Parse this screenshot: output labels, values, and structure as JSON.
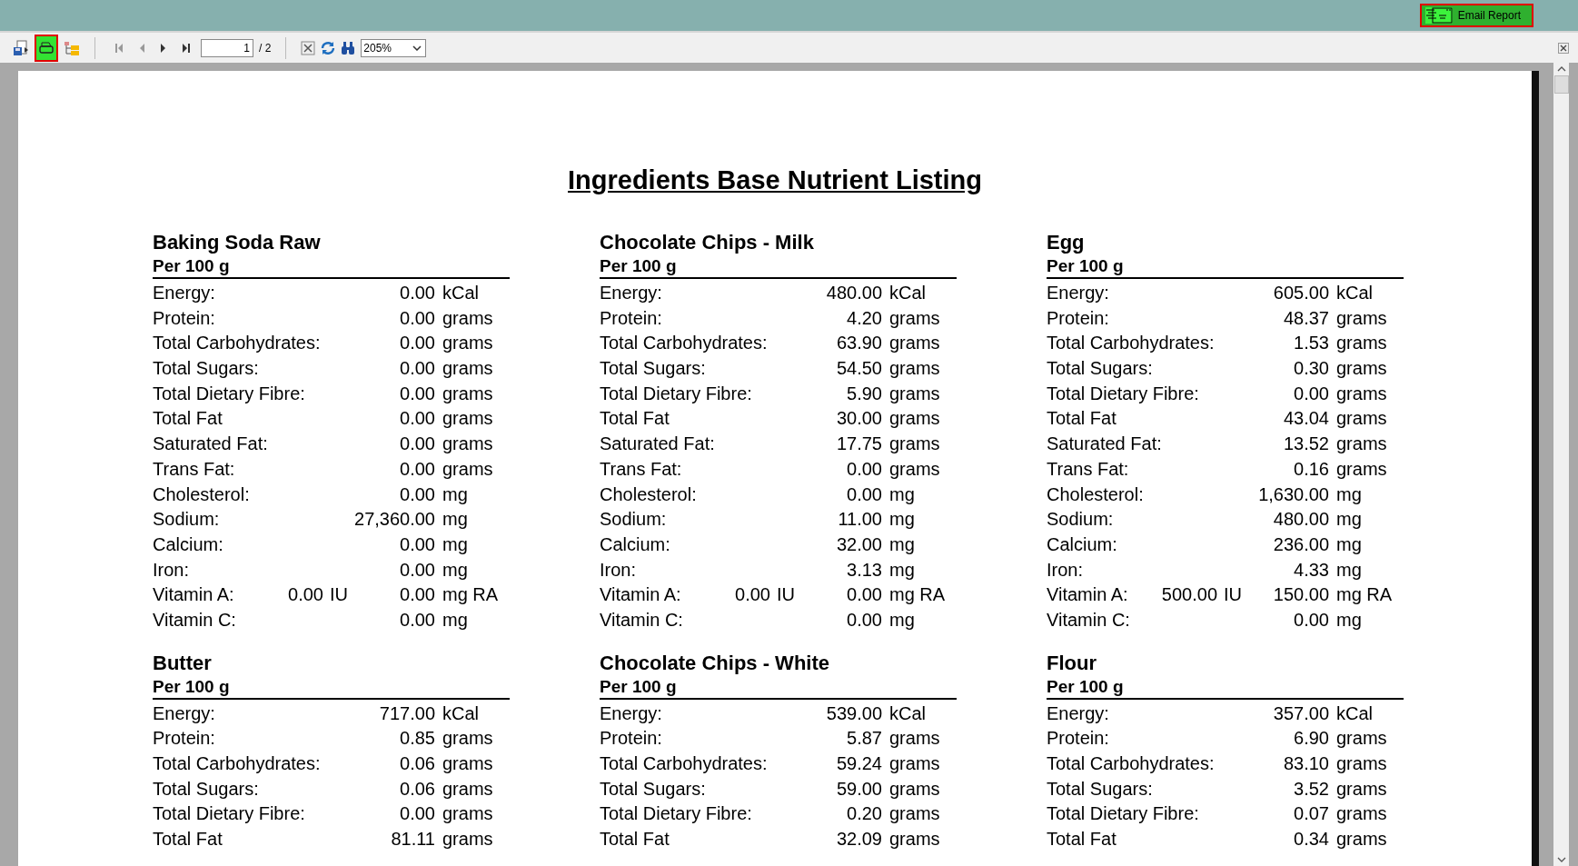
{
  "top_bar": {
    "email_button": "Email Report"
  },
  "toolbar": {
    "page_number": "1",
    "page_total": "/ 2",
    "zoom": "205%",
    "print_selected": true
  },
  "report": {
    "title": "Ingredients Base Nutrient Listing",
    "items": [
      {
        "name": "Baking Soda Raw",
        "per": "Per 100 g",
        "rows": [
          {
            "label": "Energy:",
            "value": "0.00",
            "unit": "kCal"
          },
          {
            "label": "Protein:",
            "value": "0.00",
            "unit": "grams"
          },
          {
            "label": "Total Carbohydrates:",
            "value": "0.00",
            "unit": "grams"
          },
          {
            "label": "Total Sugars:",
            "value": "0.00",
            "unit": "grams"
          },
          {
            "label": "Total Dietary Fibre:",
            "value": "0.00",
            "unit": "grams"
          },
          {
            "label": "Total Fat",
            "value": "0.00",
            "unit": "grams"
          },
          {
            "label": "Saturated Fat:",
            "value": "0.00",
            "unit": "grams"
          },
          {
            "label": "Trans Fat:",
            "value": "0.00",
            "unit": "grams"
          },
          {
            "label": "Cholesterol:",
            "value": "0.00",
            "unit": "mg"
          },
          {
            "label": "Sodium:",
            "value": "27,360.00",
            "unit": "mg"
          },
          {
            "label": "Calcium:",
            "value": "0.00",
            "unit": "mg"
          },
          {
            "label": "Iron:",
            "value": "0.00",
            "unit": "mg"
          },
          {
            "label": "Vitamin A:",
            "iu_value": "0.00",
            "iu_unit": "IU",
            "value": "0.00",
            "unit": "mg RA"
          },
          {
            "label": "Vitamin C:",
            "value": "0.00",
            "unit": "mg"
          }
        ]
      },
      {
        "name": "Chocolate Chips - Milk",
        "per": "Per 100 g",
        "rows": [
          {
            "label": "Energy:",
            "value": "480.00",
            "unit": "kCal"
          },
          {
            "label": "Protein:",
            "value": "4.20",
            "unit": "grams"
          },
          {
            "label": "Total Carbohydrates:",
            "value": "63.90",
            "unit": "grams"
          },
          {
            "label": "Total Sugars:",
            "value": "54.50",
            "unit": "grams"
          },
          {
            "label": "Total Dietary Fibre:",
            "value": "5.90",
            "unit": "grams"
          },
          {
            "label": "Total Fat",
            "value": "30.00",
            "unit": "grams"
          },
          {
            "label": "Saturated Fat:",
            "value": "17.75",
            "unit": "grams"
          },
          {
            "label": "Trans Fat:",
            "value": "0.00",
            "unit": "grams"
          },
          {
            "label": "Cholesterol:",
            "value": "0.00",
            "unit": "mg"
          },
          {
            "label": "Sodium:",
            "value": "11.00",
            "unit": "mg"
          },
          {
            "label": "Calcium:",
            "value": "32.00",
            "unit": "mg"
          },
          {
            "label": "Iron:",
            "value": "3.13",
            "unit": "mg"
          },
          {
            "label": "Vitamin A:",
            "iu_value": "0.00",
            "iu_unit": "IU",
            "value": "0.00",
            "unit": "mg RA"
          },
          {
            "label": "Vitamin C:",
            "value": "0.00",
            "unit": "mg"
          }
        ]
      },
      {
        "name": "Egg",
        "per": "Per 100 g",
        "rows": [
          {
            "label": "Energy:",
            "value": "605.00",
            "unit": "kCal"
          },
          {
            "label": "Protein:",
            "value": "48.37",
            "unit": "grams"
          },
          {
            "label": "Total Carbohydrates:",
            "value": "1.53",
            "unit": "grams"
          },
          {
            "label": "Total Sugars:",
            "value": "0.30",
            "unit": "grams"
          },
          {
            "label": "Total Dietary Fibre:",
            "value": "0.00",
            "unit": "grams"
          },
          {
            "label": "Total Fat",
            "value": "43.04",
            "unit": "grams"
          },
          {
            "label": "Saturated Fat:",
            "value": "13.52",
            "unit": "grams"
          },
          {
            "label": "Trans Fat:",
            "value": "0.16",
            "unit": "grams"
          },
          {
            "label": "Cholesterol:",
            "value": "1,630.00",
            "unit": "mg"
          },
          {
            "label": "Sodium:",
            "value": "480.00",
            "unit": "mg"
          },
          {
            "label": "Calcium:",
            "value": "236.00",
            "unit": "mg"
          },
          {
            "label": "Iron:",
            "value": "4.33",
            "unit": "mg"
          },
          {
            "label": "Vitamin A:",
            "iu_value": "500.00",
            "iu_unit": "IU",
            "value": "150.00",
            "unit": "mg RA"
          },
          {
            "label": "Vitamin C:",
            "value": "0.00",
            "unit": "mg"
          }
        ]
      },
      {
        "name": "Butter",
        "per": "Per 100 g",
        "rows": [
          {
            "label": "Energy:",
            "value": "717.00",
            "unit": "kCal"
          },
          {
            "label": "Protein:",
            "value": "0.85",
            "unit": "grams"
          },
          {
            "label": "Total Carbohydrates:",
            "value": "0.06",
            "unit": "grams"
          },
          {
            "label": "Total Sugars:",
            "value": "0.06",
            "unit": "grams"
          },
          {
            "label": "Total Dietary Fibre:",
            "value": "0.00",
            "unit": "grams"
          },
          {
            "label": "Total Fat",
            "value": "81.11",
            "unit": "grams"
          }
        ]
      },
      {
        "name": "Chocolate Chips - White",
        "per": "Per 100 g",
        "rows": [
          {
            "label": "Energy:",
            "value": "539.00",
            "unit": "kCal"
          },
          {
            "label": "Protein:",
            "value": "5.87",
            "unit": "grams"
          },
          {
            "label": "Total Carbohydrates:",
            "value": "59.24",
            "unit": "grams"
          },
          {
            "label": "Total Sugars:",
            "value": "59.00",
            "unit": "grams"
          },
          {
            "label": "Total Dietary Fibre:",
            "value": "0.20",
            "unit": "grams"
          },
          {
            "label": "Total Fat",
            "value": "32.09",
            "unit": "grams"
          }
        ]
      },
      {
        "name": "Flour",
        "per": "Per 100 g",
        "rows": [
          {
            "label": "Energy:",
            "value": "357.00",
            "unit": "kCal"
          },
          {
            "label": "Protein:",
            "value": "6.90",
            "unit": "grams"
          },
          {
            "label": "Total Carbohydrates:",
            "value": "83.10",
            "unit": "grams"
          },
          {
            "label": "Total Sugars:",
            "value": "3.52",
            "unit": "grams"
          },
          {
            "label": "Total Dietary Fibre:",
            "value": "0.07",
            "unit": "grams"
          },
          {
            "label": "Total Fat",
            "value": "0.34",
            "unit": "grams"
          }
        ]
      }
    ]
  }
}
